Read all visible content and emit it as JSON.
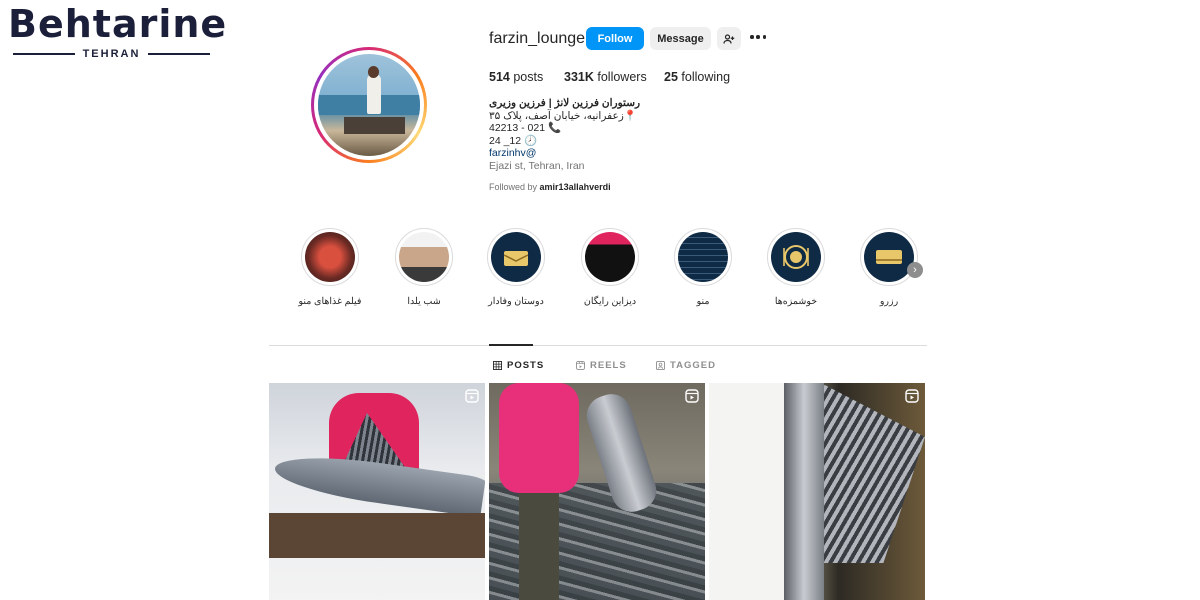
{
  "watermark": {
    "brand": "Behtarine",
    "city": "TEHRAN"
  },
  "profile": {
    "username": "farzin_lounge",
    "follow_label": "Follow",
    "message_label": "Message",
    "stats": {
      "posts_count": "514",
      "posts_label": "posts",
      "followers_count": "331K",
      "followers_label": "followers",
      "following_count": "25",
      "following_label": "following"
    },
    "bio": {
      "name": "رستوران فرزین لانژ | فرزین وزیری",
      "address_line": "زعفرانیه، خیابان آصف، پلاک ۳۵",
      "phone_line": "42213 - 021",
      "hours_line": "24 _12",
      "link": "farzinhv@",
      "location": "Ejazi st, Tehran, Iran"
    },
    "followed_by_prefix": "Followed by",
    "followed_by_user": "amir13allahverdi"
  },
  "highlights": [
    {
      "label": "فیلم غذاهای منو",
      "icon": "food-photo"
    },
    {
      "label": "شب یلدا",
      "icon": "man-portrait"
    },
    {
      "label": "دوستان وفادار",
      "icon": "friends-box"
    },
    {
      "label": "دیزاین رایگان",
      "icon": "design-screen"
    },
    {
      "label": "منو",
      "icon": "menu-list"
    },
    {
      "label": "خوشمزه‌ها",
      "icon": "plate"
    },
    {
      "label": "رزرو",
      "icon": "reservation-box"
    }
  ],
  "tabs": [
    {
      "label": "POSTS",
      "icon": "grid-icon",
      "active": true
    },
    {
      "label": "REELS",
      "icon": "reels-icon",
      "active": false
    },
    {
      "label": "TAGGED",
      "icon": "tagged-icon",
      "active": false
    }
  ],
  "colors": {
    "primary_button": "#0095f6",
    "secondary_button": "#efefef",
    "link": "#00376b",
    "muted": "#737373"
  }
}
